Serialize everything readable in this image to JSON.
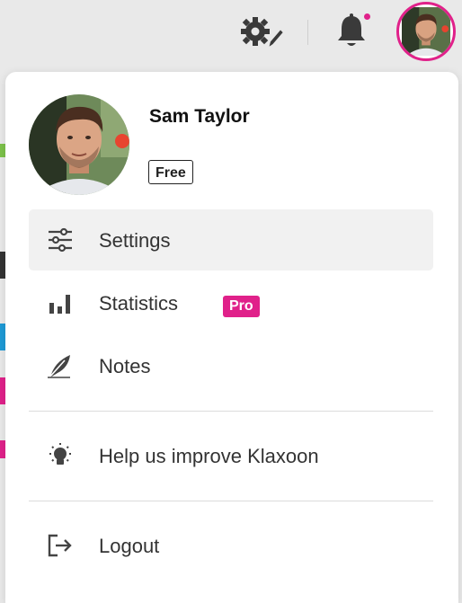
{
  "header": {
    "settings_icon": "gear-pencil-icon",
    "notifications_icon": "bell-icon",
    "has_unread_notifications": true,
    "avatar": "user-avatar"
  },
  "profile": {
    "name": "Sam Taylor",
    "plan": "Free"
  },
  "menu": {
    "settings": {
      "label": "Settings",
      "icon": "sliders-icon"
    },
    "statistics": {
      "label": "Statistics",
      "icon": "bar-chart-icon",
      "badge": "Pro"
    },
    "notes": {
      "label": "Notes",
      "icon": "feather-icon"
    },
    "feedback": {
      "label": "Help us improve Klaxoon",
      "icon": "lightbulb-icon"
    },
    "logout": {
      "label": "Logout",
      "icon": "logout-icon"
    }
  },
  "colors": {
    "accent": "#e0218a",
    "active_item_bg": "#f1f1f1",
    "text": "#333333"
  }
}
